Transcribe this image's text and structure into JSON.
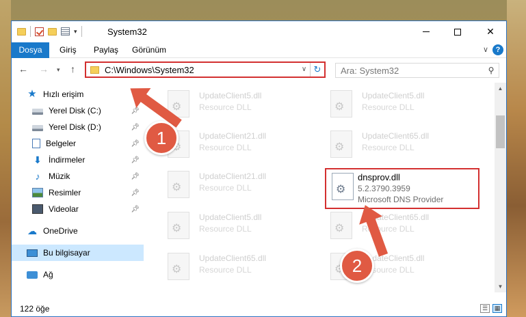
{
  "window": {
    "title": "System32"
  },
  "ribbon": {
    "tabs": [
      "Dosya",
      "Giriş",
      "Paylaş",
      "Görünüm"
    ],
    "help": "?"
  },
  "nav": {
    "address": "C:\\Windows\\System32",
    "search_placeholder": "Ara: System32"
  },
  "sidebar": {
    "items": [
      {
        "label": "Hızlı erişim",
        "icon": "star-icon"
      },
      {
        "label": "Yerel Disk (C:)",
        "icon": "drive-icon",
        "pinned": true
      },
      {
        "label": "Yerel Disk (D:)",
        "icon": "drive-icon",
        "pinned": true
      },
      {
        "label": "Belgeler",
        "icon": "documents-icon",
        "pinned": true
      },
      {
        "label": "İndirmeler",
        "icon": "download-icon",
        "pinned": true
      },
      {
        "label": "Müzik",
        "icon": "music-icon",
        "pinned": true
      },
      {
        "label": "Resimler",
        "icon": "pictures-icon",
        "pinned": true
      },
      {
        "label": "Videolar",
        "icon": "videos-icon",
        "pinned": true
      },
      {
        "label": "OneDrive",
        "icon": "cloud-icon"
      },
      {
        "label": "Bu bilgisayar",
        "icon": "computer-icon",
        "selected": true
      },
      {
        "label": "Ağ",
        "icon": "network-icon"
      }
    ]
  },
  "files": [
    {
      "name": "UpdateClient5.dll",
      "desc": "Resource DLL"
    },
    {
      "name": "UpdateClient5.dll",
      "desc": "Resource DLL"
    },
    {
      "name": "UpdateClient21.dll",
      "desc": "Resource DLL"
    },
    {
      "name": "UpdateClient65.dll",
      "desc": "Resource DLL"
    },
    {
      "name": "UpdateClient21.dll",
      "desc": "Resource DLL"
    },
    {
      "name": "dnsprov.dll",
      "version": "5.2.3790.3959",
      "desc": "Microsoft DNS Provider",
      "highlighted": true
    },
    {
      "name": "UpdateClient5.dll",
      "desc": "Resource DLL"
    },
    {
      "name": "UpdateClient65.dll",
      "desc": "Resource DLL"
    },
    {
      "name": "UpdateClient65.dll",
      "desc": "Resource DLL"
    },
    {
      "name": "UpdateClient5.dll",
      "desc": "Resource DLL"
    }
  ],
  "status": {
    "count": "122 öğe"
  },
  "annotations": {
    "step1": "1",
    "step2": "2",
    "color": "#e05a43"
  },
  "colors": {
    "accent": "#1979ca",
    "highlight_border": "#d32f2f"
  }
}
